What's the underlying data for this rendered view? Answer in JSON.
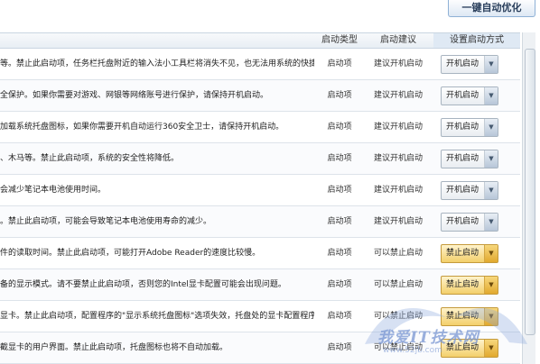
{
  "toolbar": {
    "optimize_label": "一键自动优化"
  },
  "columns": {
    "type": "启动类型",
    "suggest": "启动建议",
    "method": "设置启动方式"
  },
  "rows": [
    {
      "desc": "等。禁止此启动项，任务栏托盘附近的输入法小工具栏将消失不见，也无法用系统的快捷键切...",
      "type": "启动项",
      "suggest": "建议开机启动",
      "setting": "开机启动",
      "state": "enabled"
    },
    {
      "desc": "全保护。如果你需要对游戏、网银等网络账号进行保护，请保持开机启动。",
      "type": "启动项",
      "suggest": "建议开机启动",
      "setting": "开机启动",
      "state": "enabled"
    },
    {
      "desc": "加载系统托盘图标，如果你需要开机自动运行360安全卫士，请保持开机启动。",
      "type": "启动项",
      "suggest": "建议开机启动",
      "setting": "开机启动",
      "state": "enabled"
    },
    {
      "desc": "、木马等。禁止此启动项，系统的安全性将降低。",
      "type": "启动项",
      "suggest": "建议开机启动",
      "setting": "开机启动",
      "state": "enabled"
    },
    {
      "desc": "会减少笔记本电池使用时间。",
      "type": "启动项",
      "suggest": "建议开机启动",
      "setting": "开机启动",
      "state": "enabled"
    },
    {
      "desc": "。禁止此启动项，可能会导致笔记本电池使用寿命的减少。",
      "type": "启动项",
      "suggest": "建议开机启动",
      "setting": "开机启动",
      "state": "enabled"
    },
    {
      "desc": "件的读取时间。禁止此启动项，可能打开Adobe Reader的速度比较慢。",
      "type": "启动项",
      "suggest": "可以禁止启动",
      "setting": "禁止启动",
      "state": "disabled"
    },
    {
      "desc": "备的显示模式。请不要禁止此启动项，否则您的Intel显卡配置可能会出现问题。",
      "type": "启动项",
      "suggest": "可以禁止启动",
      "setting": "禁止启动",
      "state": "disabled"
    },
    {
      "desc": "显卡。禁止此启动项，配置程序的\"显示系统托盘图标\"选项失效，托盘处的显卡配置程序图标...",
      "type": "启动项",
      "suggest": "可以禁止启动",
      "setting": "禁止启动",
      "state": "disabled"
    },
    {
      "desc": "截显卡的用户界面。禁止此启动项，托盘图标也将不自动加载。",
      "type": "启动项",
      "suggest": "可以禁止启动",
      "setting": "禁止启动",
      "state": "disabled"
    }
  ],
  "icons": {
    "dropdown": "chevron-down-icon"
  },
  "colors": {
    "accent": "#8fb1d6",
    "disabled_button": "#f3cf6b",
    "header_bg": "#e8eef4"
  },
  "watermark": {
    "text": "我爱IT技术网",
    "sub": "www.52jb.com"
  }
}
